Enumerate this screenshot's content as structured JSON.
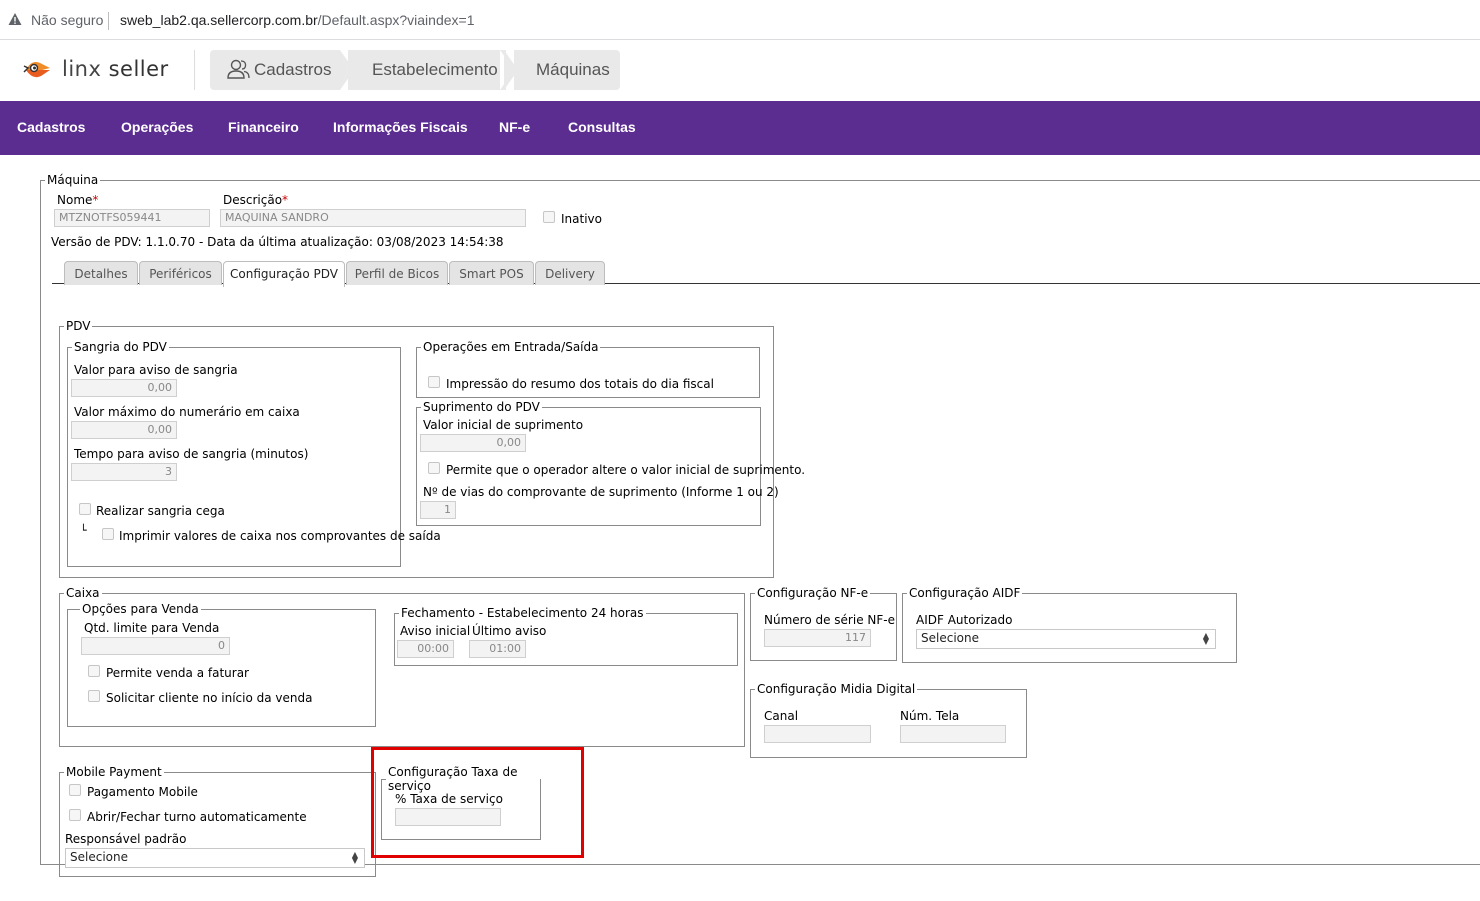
{
  "browser": {
    "security": "Não seguro",
    "url_host": "sweb_lab2.qa.sellercorp.com.br",
    "url_path": "/Default.aspx?viaindex=1"
  },
  "header": {
    "logo_text_1": "linx",
    "logo_text_2": "seller",
    "breadcrumbs": [
      "Cadastros",
      "Estabelecimento",
      "Máquinas"
    ]
  },
  "nav": [
    "Cadastros",
    "Operações",
    "Financeiro",
    "Informações Fiscais",
    "NF-e",
    "Consultas"
  ],
  "maquina": {
    "legend": "Máquina",
    "nome_label": "Nome",
    "nome_value": "MTZNOTFS059441",
    "descricao_label": "Descrição",
    "descricao_value": "MAQUINA SANDRO",
    "inativo_label": "Inativo",
    "versao": "Versão de PDV: 1.1.0.70 - Data da última atualização: 03/08/2023 14:54:38",
    "required_mark": "*"
  },
  "tabs": [
    "Detalhes",
    "Periféricos",
    "Configuração PDV",
    "Perfil de Bicos",
    "Smart POS",
    "Delivery"
  ],
  "pdv": {
    "legend": "PDV",
    "sangria": {
      "legend": "Sangria do PDV",
      "valor_aviso_label": "Valor para aviso de sangria",
      "valor_aviso": "0,00",
      "valor_max_label": "Valor máximo do numerário em caixa",
      "valor_max": "0,00",
      "tempo_label": "Tempo para aviso de sangria (minutos)",
      "tempo": "3",
      "realizar_cega": "Realizar sangria cega",
      "imprimir_valores": "Imprimir valores de caixa nos comprovantes de saída",
      "tree_mark": "└"
    },
    "operacoes": {
      "legend": "Operações em Entrada/Saída",
      "impressao": "Impressão do resumo dos totais do dia fiscal"
    },
    "suprimento": {
      "legend": "Suprimento do PDV",
      "valor_inicial_label": "Valor inicial de suprimento",
      "valor_inicial": "0,00",
      "permite_alterar": "Permite que o operador altere o valor inicial de suprimento.",
      "vias_label": "Nº de vias do comprovante de suprimento (Informe 1 ou 2)",
      "vias": "1"
    }
  },
  "caixa": {
    "legend": "Caixa",
    "opcoes": {
      "legend": "Opções para Venda",
      "qtd_label": "Qtd. limite para Venda",
      "qtd": "0",
      "permite_faturar": "Permite venda a faturar",
      "solicitar_cliente": "Solicitar cliente no início da venda"
    },
    "fechamento": {
      "legend": "Fechamento - Estabelecimento 24 horas",
      "aviso_inicial_label": "Aviso inicial",
      "aviso_inicial": "00:00",
      "ultimo_aviso_label": "Último aviso",
      "ultimo_aviso": "01:00"
    }
  },
  "nfe": {
    "legend": "Configuração NF-e",
    "serie_label": "Número de série NF-e",
    "serie": "117"
  },
  "aidf": {
    "legend": "Configuração AIDF",
    "autorizado_label": "AIDF Autorizado",
    "autorizado": "Selecione"
  },
  "midia": {
    "legend": "Configuração Midia Digital",
    "canal_label": "Canal",
    "canal": "",
    "tela_label": "Núm. Tela",
    "tela": ""
  },
  "mobile": {
    "legend": "Mobile Payment",
    "pagamento": "Pagamento Mobile",
    "abrir_fechar": "Abrir/Fechar turno automaticamente",
    "responsavel_label": "Responsável padrão",
    "responsavel": "Selecione"
  },
  "taxa": {
    "legend": "Configuração Taxa de serviço",
    "percent_label": "% Taxa de serviço",
    "percent": ""
  },
  "colors": {
    "nav_bg": "#5c2d91",
    "highlight": "#e00000"
  }
}
